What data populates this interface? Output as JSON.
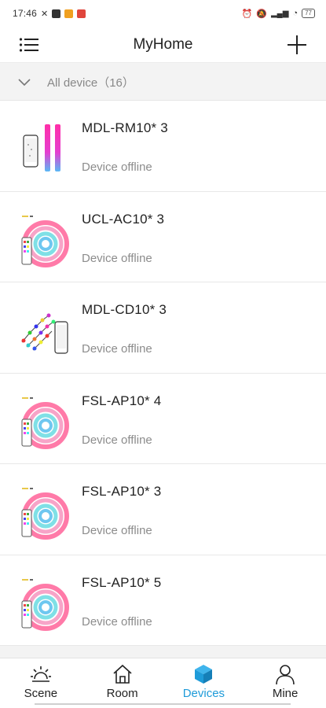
{
  "status_bar": {
    "time": "17:46",
    "battery": "77"
  },
  "header": {
    "title": "MyHome"
  },
  "group": {
    "label": "All device（16）"
  },
  "devices": [
    {
      "name": "MDL-RM10* 3",
      "status": "Device offline",
      "image": "rgb-light-bars-with-phone"
    },
    {
      "name": "UCL-AC10* 3",
      "status": "Device offline",
      "image": "rgb-led-strip-reel"
    },
    {
      "name": "MDL-CD10* 3",
      "status": "Device offline",
      "image": "rgb-string-lights-with-phone"
    },
    {
      "name": "FSL-AP10* 4",
      "status": "Device offline",
      "image": "rgb-led-strip-reel"
    },
    {
      "name": "FSL-AP10* 3",
      "status": "Device offline",
      "image": "rgb-led-strip-reel"
    },
    {
      "name": "FSL-AP10* 5",
      "status": "Device offline",
      "image": "rgb-led-strip-reel"
    }
  ],
  "tabs": [
    {
      "label": "Scene",
      "icon": "sun-icon",
      "active": false
    },
    {
      "label": "Room",
      "icon": "house-icon",
      "active": false
    },
    {
      "label": "Devices",
      "icon": "cube-icon",
      "active": true
    },
    {
      "label": "Mine",
      "icon": "person-icon",
      "active": false
    }
  ],
  "colors": {
    "accent": "#1e9bd9",
    "offline_text": "#8c8c8c"
  }
}
